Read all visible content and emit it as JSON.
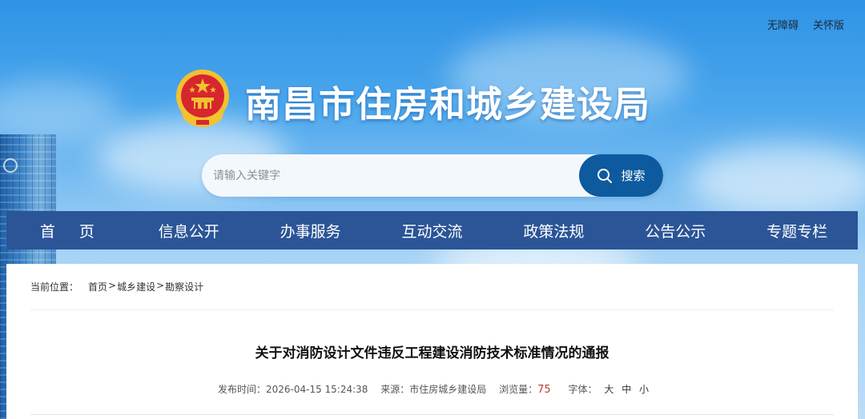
{
  "top_links": [
    "无障碍",
    "关怀版"
  ],
  "site": {
    "title": "南昌市住房和城乡建设局"
  },
  "search": {
    "placeholder": "请输入关键字",
    "button_label": "搜索"
  },
  "nav": [
    "首页",
    "信息公开",
    "办事服务",
    "互动交流",
    "政策法规",
    "公告公示",
    "专题专栏"
  ],
  "breadcrumb": {
    "label": "当前位置：",
    "items": [
      "首页",
      "城乡建设",
      "勘察设计"
    ],
    "separator": ">"
  },
  "article": {
    "title": "关于对消防设计文件违反工程建设消防技术标准情况的通报",
    "published_label": "发布时间：",
    "published": "2026-04-15 15:24:38",
    "source_label": "来源：",
    "source": "市住房城乡建设局",
    "views_label": "浏览量：",
    "views": "75",
    "font_label": "字体：",
    "font_sizes": [
      "大",
      "中",
      "小"
    ]
  },
  "colors": {
    "nav_bg": "#2b5597",
    "search_btn": "#0d5a9e",
    "views": "#c0392b",
    "emblem_red": "#d8262e",
    "emblem_gold": "#f2c230"
  }
}
